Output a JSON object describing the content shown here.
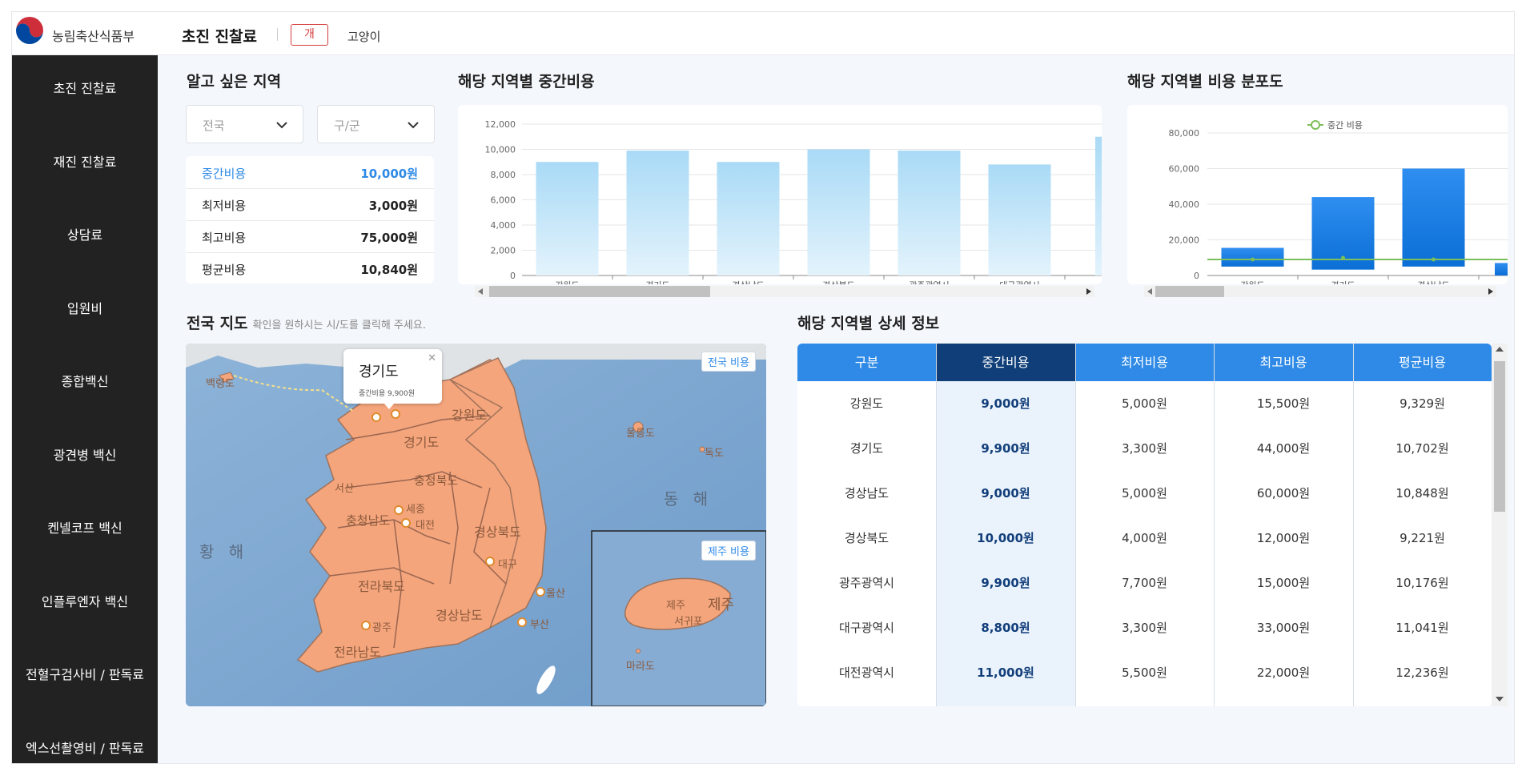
{
  "header": {
    "brand": "농림축산식품부",
    "title": "초진 진찰료",
    "animal_tabs": [
      "개",
      "고양이"
    ]
  },
  "sidebar": {
    "items": [
      "초진 진찰료",
      "재진 진찰료",
      "상담료",
      "입원비",
      "종합백신",
      "광견병 백신",
      "켄넬코프 백신",
      "인플루엔자 백신",
      "전혈구검사비 / 판독료",
      "엑스선촬영비 / 판독료"
    ]
  },
  "region": {
    "title": "알고 싶은 지역",
    "select1": "전국",
    "select2": "구/군"
  },
  "summary": [
    {
      "label": "중간비용",
      "value": "10,000원"
    },
    {
      "label": "최저비용",
      "value": "3,000원"
    },
    {
      "label": "최고비용",
      "value": "75,000원"
    },
    {
      "label": "평균비용",
      "value": "10,840원"
    }
  ],
  "chart_median_title": "해당 지역별 중간비용",
  "chart_dist_title": "해당 지역별 비용 분포도",
  "chart_data": [
    {
      "type": "bar",
      "categories": [
        "강원도",
        "경기도",
        "경상남도",
        "경상북도",
        "광주광역시",
        "대구광역시"
      ],
      "values": [
        9000,
        9900,
        9000,
        10000,
        9900,
        8800
      ],
      "ylim": [
        0,
        12000
      ],
      "yticks": [
        "12,000",
        "10,000",
        "8,000",
        "6,000",
        "4,000",
        "2,000",
        "0"
      ],
      "grid": true
    },
    {
      "type": "bar",
      "categories": [
        "강원도",
        "경기도",
        "경상남도"
      ],
      "series": [
        {
          "type": "bar",
          "lows": [
            5000,
            3300,
            5000
          ],
          "highs": [
            15500,
            44000,
            60000
          ]
        },
        {
          "name": "중간 비용",
          "type": "line",
          "values": [
            9000,
            9900,
            9000
          ]
        }
      ],
      "ylim": [
        0,
        80000
      ],
      "yticks": [
        "80,000",
        "60,000",
        "40,000",
        "20,000",
        "0"
      ],
      "legend": "top"
    }
  ],
  "map": {
    "title": "전국 지도",
    "subtitle": "확인을 원하시는 시/도를 클릭해 주세요.",
    "tooltip_region": "경기도",
    "tooltip_detail": "중간비용 9,900원",
    "btn_all": "전국 비용",
    "btn_jeju": "제주 비용",
    "sea_west": "황 해",
    "sea_east": "동 해",
    "labels": [
      "백령도",
      "강원도",
      "경기도",
      "충청북도",
      "충청남도",
      "세종",
      "대전",
      "경상북도",
      "대구",
      "전라북도",
      "경상남도",
      "울산",
      "부산",
      "광주",
      "전라남도",
      "울릉도",
      "독도",
      "서산",
      "제주",
      "제주",
      "서귀포",
      "마라도"
    ]
  },
  "detail": {
    "title": "해당 지역별 상세 정보",
    "headers": [
      "구분",
      "중간비용",
      "최저비용",
      "최고비용",
      "평균비용"
    ],
    "rows": [
      [
        "강원도",
        "9,000원",
        "5,000원",
        "15,500원",
        "9,329원"
      ],
      [
        "경기도",
        "9,900원",
        "3,300원",
        "44,000원",
        "10,702원"
      ],
      [
        "경상남도",
        "9,000원",
        "5,000원",
        "60,000원",
        "10,848원"
      ],
      [
        "경상북도",
        "10,000원",
        "4,000원",
        "12,000원",
        "9,221원"
      ],
      [
        "광주광역시",
        "9,900원",
        "7,700원",
        "15,000원",
        "10,176원"
      ],
      [
        "대구광역시",
        "8,800원",
        "3,300원",
        "33,000원",
        "11,041원"
      ],
      [
        "대전광역시",
        "11,000원",
        "5,500원",
        "22,000원",
        "12,236원"
      ]
    ]
  },
  "colors": {
    "primary": "#2e8ae6",
    "dark_header": "#0f3e78",
    "sidebar": "#222222",
    "map_land": "#f4a57c",
    "map_sea": "#7fa9d3"
  }
}
